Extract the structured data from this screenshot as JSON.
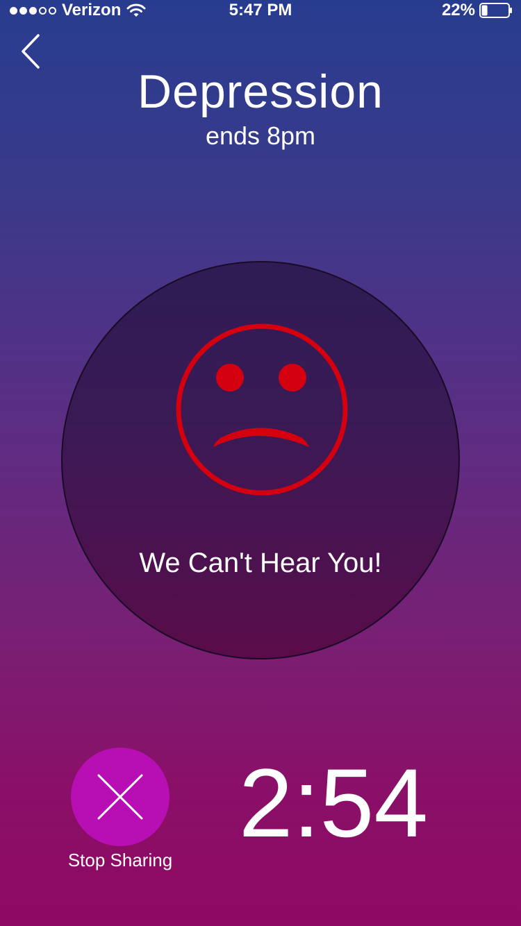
{
  "status_bar": {
    "carrier": "Verizon",
    "time": "5:47 PM",
    "battery": "22%",
    "battery_level": 0.22,
    "signal_bars_filled": 3,
    "signal_bars_total": 5
  },
  "header": {
    "title": "Depression",
    "subtitle": "ends 8pm"
  },
  "status_panel": {
    "message": "We Can't Hear You!",
    "face_icon": "sad-face-icon",
    "face_color": "#d40010"
  },
  "controls": {
    "stop_label": "Stop Sharing",
    "stop_icon": "close-icon",
    "stop_color": "#b80fb5",
    "countdown": "2:54"
  }
}
